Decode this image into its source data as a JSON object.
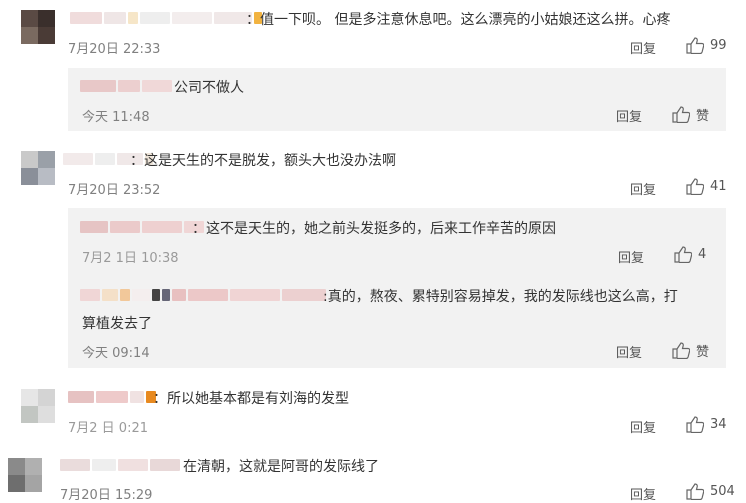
{
  "colors": {
    "reply_bg": "#f2f2f2",
    "text": "#333333",
    "meta": "#808080"
  },
  "icons": {
    "like": "thumbs-up-icon"
  },
  "comments": [
    {
      "text": "：值一下呗。 但是多注意休息吧。这么漂亮的小姑娘还这么拼。心疼",
      "time": "7月20日 22:33",
      "reply_label": "回复",
      "likes": "99",
      "replies": [
        {
          "text": "公司不做人",
          "time": "今天 11:48",
          "reply_label": "回复",
          "likes": "赞"
        }
      ]
    },
    {
      "text": "：这是天生的不是脱发，额头大也没办法啊",
      "time": "7月20日 23:52",
      "reply_label": "回复",
      "likes": "41",
      "replies": [
        {
          "text": "：这不是天生的，她之前头发挺多的，后来工作辛苦的原因",
          "time": "7月2 1日 10:38",
          "reply_label": "回复",
          "likes": "4"
        },
        {
          "text_line1": ":真的，熬夜、累特别容易掉发，我的发际线也这么高，打",
          "text_line2": "算植发去了",
          "time": "今天 09:14",
          "reply_label": "回复",
          "likes": "赞"
        }
      ]
    },
    {
      "text": "：所以她基本都是有刘海的发型",
      "time": "7月2 日 0:21",
      "reply_label": "回复",
      "likes": "34",
      "replies": []
    },
    {
      "text": "在清朝，这就是阿哥的发际线了",
      "time": "7月20日 15:29",
      "reply_label": "回复",
      "likes": "504",
      "replies": []
    }
  ]
}
